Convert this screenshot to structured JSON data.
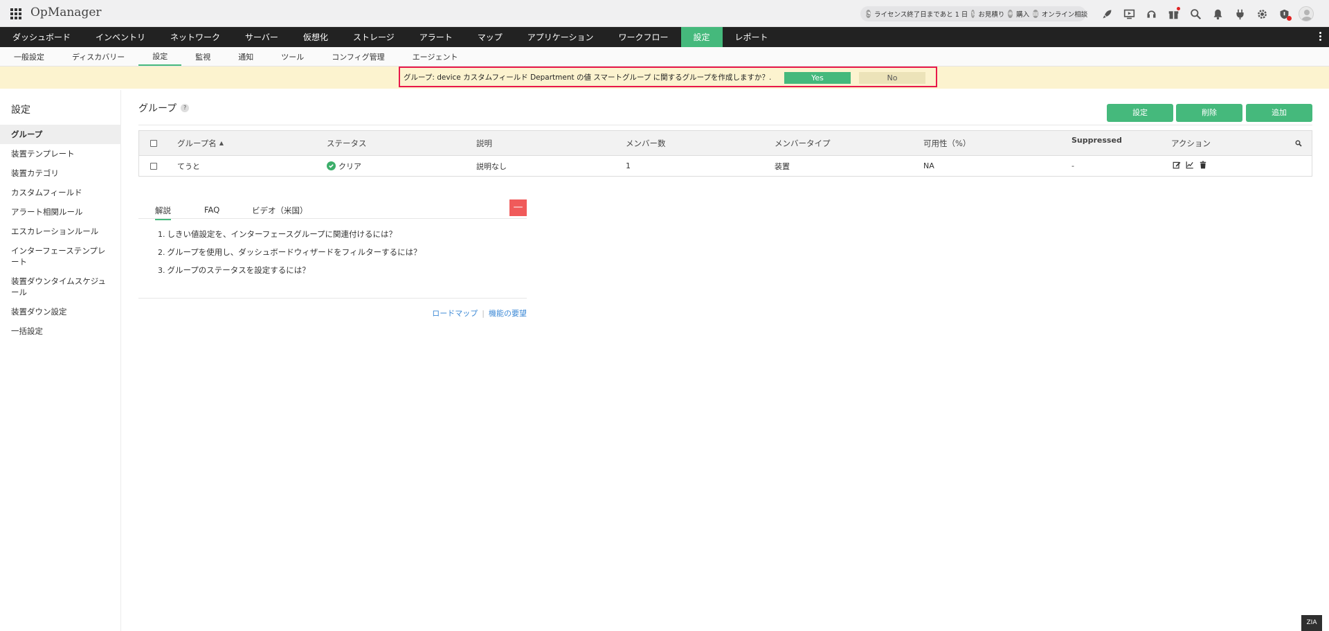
{
  "app": {
    "brand": "OpManager"
  },
  "header": {
    "license_text": "ライセンス終了日まであと 1 日",
    "quote_text": "お見積り",
    "purchase_text": "購入",
    "consult_text": "オンライン相談",
    "icons": [
      "rocket-icon",
      "screen-icon",
      "headset-icon",
      "gift-icon",
      "search-icon",
      "bell-icon",
      "plug-icon",
      "gear-icon",
      "shield-alert-icon",
      "user-avatar"
    ]
  },
  "main_nav": {
    "items": [
      "ダッシュボード",
      "インベントリ",
      "ネットワーク",
      "サーバー",
      "仮想化",
      "ストレージ",
      "アラート",
      "マップ",
      "アプリケーション",
      "ワークフロー",
      "設定",
      "レポート"
    ],
    "active": "設定"
  },
  "sub_nav": {
    "items": [
      "一般設定",
      "ディスカバリー",
      "設定",
      "監視",
      "通知",
      "ツール",
      "コンフィグ管理",
      "エージェント"
    ],
    "active": "設定"
  },
  "notification": {
    "text": "グループ: device カスタムフィールド Department の値 スマートグループ に関するグループを作成しますか？.",
    "yes_label": "Yes",
    "no_label": "No"
  },
  "sidebar": {
    "title": "設定",
    "items": [
      "グループ",
      "装置テンプレート",
      "装置カテゴリ",
      "カスタムフィールド",
      "アラート相関ルール",
      "エスカレーションルール",
      "インターフェーステンプレート",
      "装置ダウンタイムスケジュール",
      "装置ダウン設定",
      "一括設定"
    ],
    "active": "グループ"
  },
  "page": {
    "title": "グループ",
    "help_mark": "?",
    "buttons": {
      "settings": "設定",
      "delete": "削除",
      "add": "追加"
    }
  },
  "table": {
    "headers": [
      "グループ名",
      "ステータス",
      "説明",
      "メンバー数",
      "メンバータイプ",
      "可用性（%）",
      "Suppressed",
      "アクション"
    ],
    "rows": [
      {
        "name": "てうと",
        "status": "クリア",
        "description": "説明なし",
        "members": "1",
        "member_type": "装置",
        "availability": "NA",
        "suppressed": "-"
      }
    ]
  },
  "help": {
    "tabs": [
      "解説",
      "FAQ",
      "ビデオ（米国）"
    ],
    "active_tab": "解説",
    "collapse_label": "—",
    "items": [
      {
        "num": "1.",
        "text": "しきい値設定を、インターフェースグループに関連付けるには？"
      },
      {
        "num": "2.",
        "text": "グループを使用し、ダッシュボードウィザードをフィルターするには？"
      },
      {
        "num": "3.",
        "text": "グループのステータスを設定するには？"
      }
    ],
    "links": {
      "roadmap": "ロードマップ",
      "sep": "|",
      "feature_request": "機能の要望"
    }
  },
  "footer": {
    "lang_badge": "ZIA"
  },
  "colors": {
    "accent": "#45b97c",
    "nav_bg": "#222222",
    "banner_bg": "#fcf3cf",
    "banner_border": "#e8184a",
    "danger": "#f05a5a"
  }
}
